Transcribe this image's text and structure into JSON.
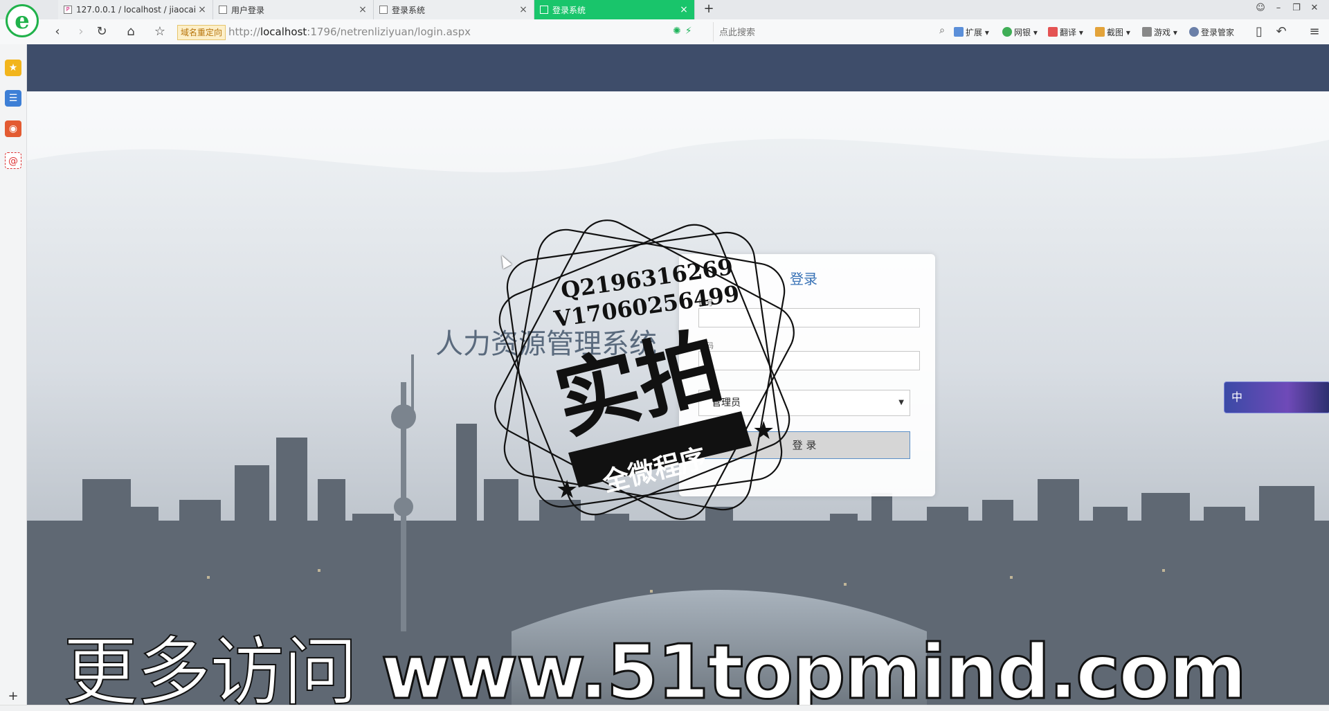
{
  "browser": {
    "tabs": [
      {
        "label": "127.0.0.1 / localhost / jiaocai",
        "icon": "phpmyadmin-icon",
        "active": false
      },
      {
        "label": "用户登录",
        "icon": "page-icon",
        "active": false
      },
      {
        "label": "登录系统",
        "icon": "page-icon",
        "active": false
      },
      {
        "label": "登录系统",
        "icon": "page-icon",
        "active": true
      }
    ],
    "redirect_badge": "域名重定向",
    "url_prefix": "http://",
    "url_host": "localhost",
    "url_rest": ":1796/netrenliziyuan/login.aspx",
    "search_placeholder": "点此搜索",
    "toolbar": {
      "extend": "扩展",
      "netbank": "网银",
      "translate": "翻译",
      "screenshot": "截图",
      "games": "游戏",
      "login_manager": "登录管家"
    }
  },
  "login": {
    "system_title": "人力资源管理系统",
    "card_title": "登录",
    "account_label": "账号",
    "password_label": "密码",
    "account_value": "",
    "password_value": "",
    "role_selected": "管理员",
    "submit_label": "登  录"
  },
  "stamp": {
    "line1": "Q2196316269",
    "line2": "V17060256499",
    "main": "实拍",
    "ribbon": "全微程序"
  },
  "side_widget": {
    "label": "中"
  },
  "watermark": {
    "prefix": "更多访问",
    "site": "www.51topmind.com"
  },
  "colors": {
    "header": "#3e4d6a",
    "active_tab": "#19c56b",
    "login_title": "#3872b6"
  }
}
